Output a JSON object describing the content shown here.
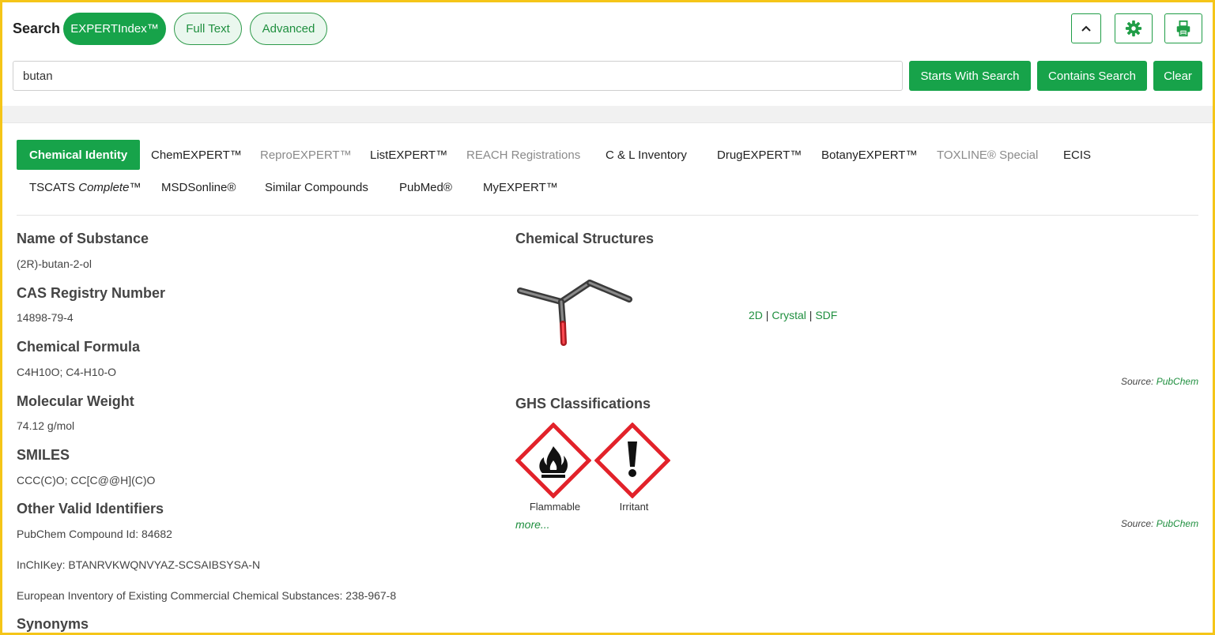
{
  "header": {
    "search_label": "Search",
    "modes": [
      "EXPERTIndex™",
      "Full Text",
      "Advanced"
    ],
    "icons": [
      "chevron-up-icon",
      "gear-icon",
      "printer-icon"
    ],
    "search_value": "butan",
    "buttons": {
      "starts_with": "Starts With Search",
      "contains": "Contains Search",
      "clear": "Clear"
    }
  },
  "tabs": {
    "row1": [
      "Chemical Identity",
      "ChemEXPERT™",
      "ReproEXPERT™",
      "ListEXPERT™",
      "REACH Registrations",
      "C & L Inventory",
      "DrugEXPERT™",
      "BotanyEXPERT™",
      "TOXLINE® Special",
      "ECIS"
    ],
    "row2_tscats_a": "TSCATS ",
    "row2_tscats_b": "Complete",
    "row2_tscats_c": "™",
    "row2": [
      "MSDSonline®",
      "Similar Compounds",
      "PubMed®",
      "MyEXPERT™"
    ]
  },
  "identity": {
    "name_label": "Name of Substance",
    "name_value": "(2R)-butan-2-ol",
    "cas_label": "CAS Registry Number",
    "cas_value": "14898-79-4",
    "formula_label": "Chemical Formula",
    "formula_value": "C4H10O; C4-H10-O",
    "mw_label": "Molecular Weight",
    "mw_value": "74.12 g/mol",
    "smiles_label": "SMILES",
    "smiles_value": "CCC(C)O; CC[C@@H](C)O",
    "other_label": "Other Valid Identifiers",
    "other_values": [
      "PubChem Compound Id: 84682",
      "InChIKey: BTANRVKWQNVYAZ-SCSAIBSYSA-N",
      "European Inventory of Existing Commercial Chemical Substances: 238-967-8"
    ],
    "synonyms_label": "Synonyms"
  },
  "structures": {
    "title": "Chemical Structures",
    "links": [
      "2D",
      "Crystal",
      "SDF"
    ],
    "separator": "|",
    "source_label": "Source: ",
    "source_link": "PubChem"
  },
  "ghs": {
    "title": "GHS Classifications",
    "pictograms": [
      {
        "label": "Flammable",
        "icon": "flame-pictogram-icon"
      },
      {
        "label": "Irritant",
        "icon": "exclamation-pictogram-icon"
      }
    ],
    "more": "more...",
    "source_label": "Source: ",
    "source_link": "PubChem",
    "pictogram_color": "#e2222a"
  },
  "colors": {
    "accent": "#17a34a",
    "frame": "#f5c518"
  }
}
